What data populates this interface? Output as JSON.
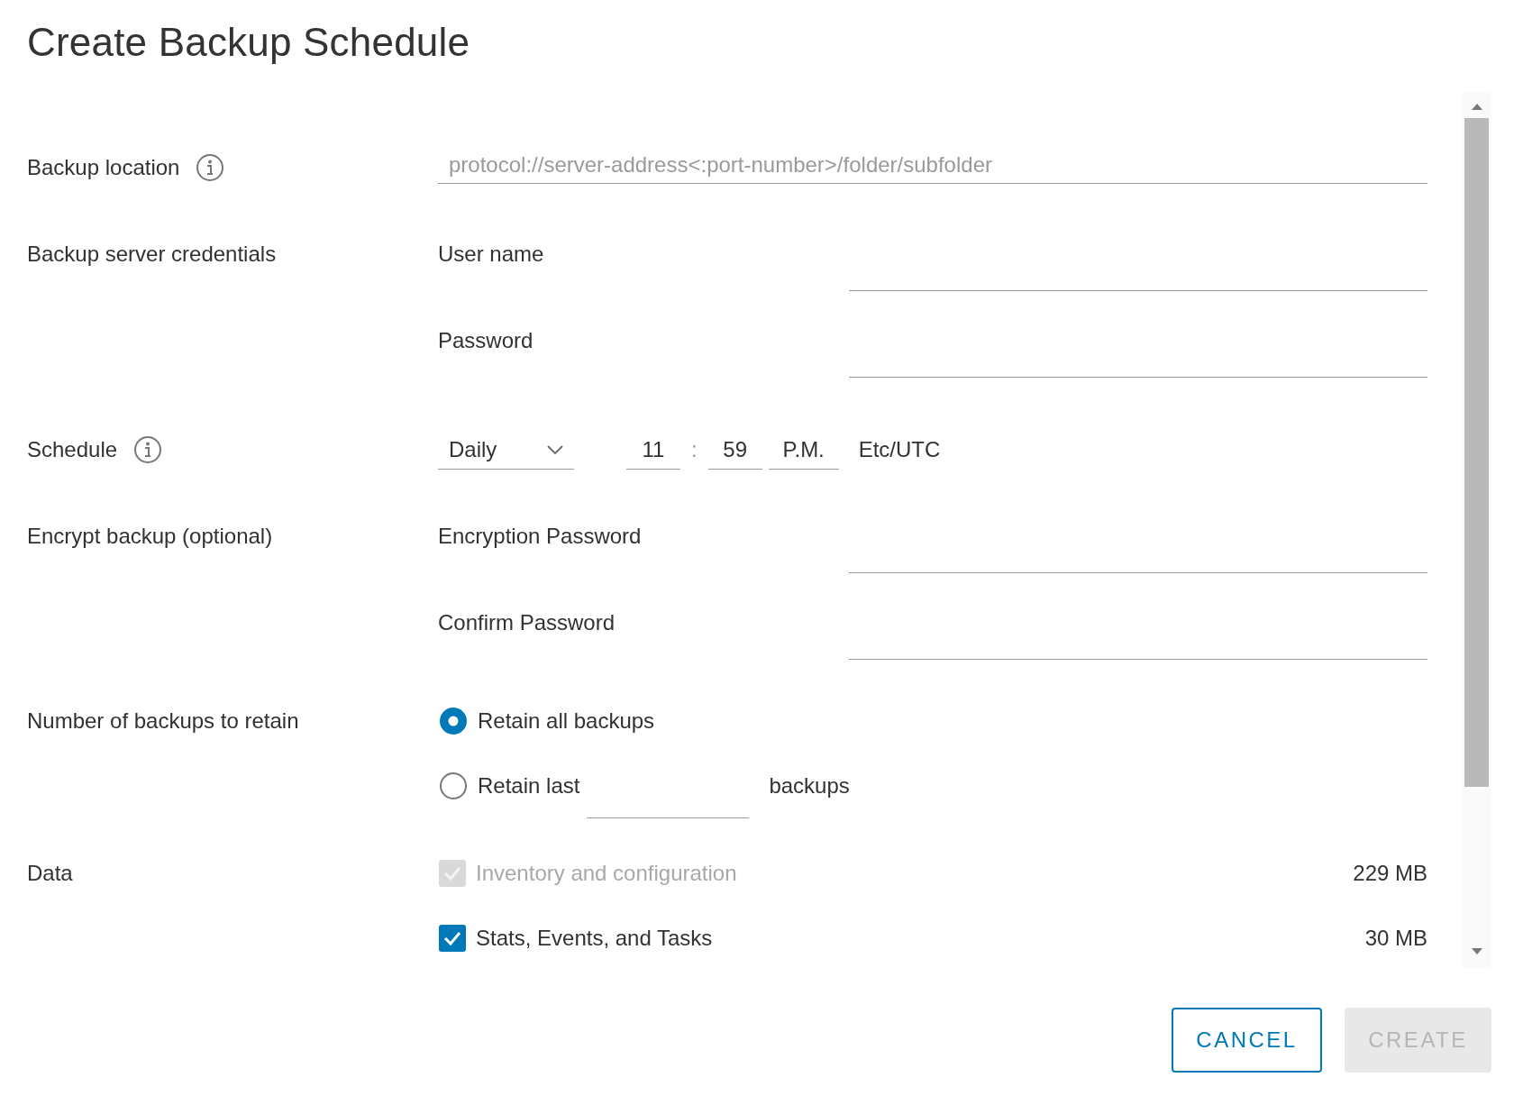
{
  "title": "Create Backup Schedule",
  "backup_location": {
    "label": "Backup location",
    "placeholder": "protocol://server-address<:port-number>/folder/subfolder"
  },
  "credentials": {
    "label": "Backup server credentials",
    "fields": [
      {
        "label": "User name"
      },
      {
        "label": "Password"
      }
    ]
  },
  "schedule": {
    "label": "Schedule",
    "frequency": "Daily",
    "hour": "11",
    "separator": ":",
    "minute": "59",
    "period": "P.M.",
    "timezone": "Etc/UTC"
  },
  "encryption": {
    "label": "Encrypt backup (optional)",
    "fields": [
      {
        "label": "Encryption Password"
      },
      {
        "label": "Confirm Password"
      }
    ]
  },
  "retention": {
    "label": "Number of backups to retain",
    "options": [
      {
        "kind": "plain",
        "label": "Retain all backups",
        "selected": true
      },
      {
        "kind": "count",
        "label": "Retain last",
        "suffix": "backups",
        "selected": false
      }
    ]
  },
  "data": {
    "label": "Data",
    "items": [
      {
        "label": "Inventory and configuration",
        "size": "229 MB",
        "checked": true,
        "disabled": true
      },
      {
        "label": "Stats, Events, and Tasks",
        "size": "30 MB",
        "checked": true,
        "disabled": false
      }
    ]
  },
  "buttons": [
    {
      "label": "CANCEL",
      "kind": "secondary",
      "disabled": false
    },
    {
      "label": "CREATE",
      "kind": "primary",
      "disabled": true
    }
  ]
}
